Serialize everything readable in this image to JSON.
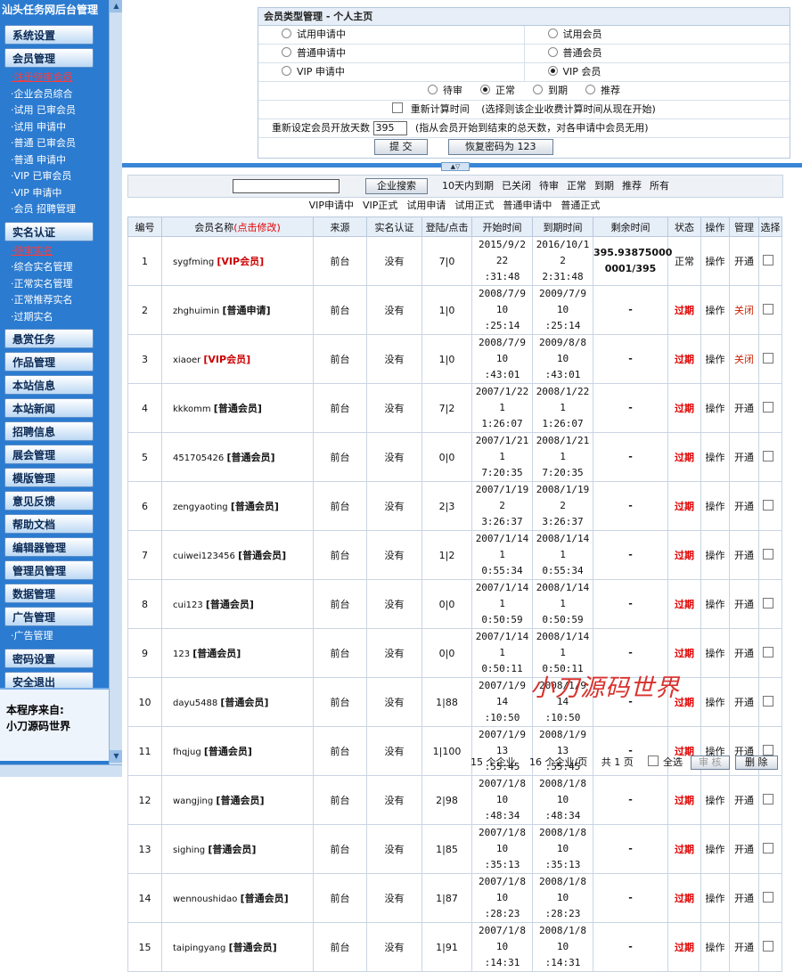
{
  "sidebar": {
    "title": "汕头任务网后台管理",
    "groups": {
      "g0": "系统设置",
      "g1": "会员管理",
      "g2": "实名认证",
      "g3": "悬赏任务",
      "g4": "作品管理",
      "g5": "本站信息",
      "g6": "本站新闻",
      "g7": "招聘信息",
      "g8": "展会管理",
      "g9": "模版管理",
      "g10": "意见反馈",
      "g11": "帮助文档",
      "g12": "编辑器管理",
      "g13": "管理员管理",
      "g14": "数据管理",
      "g15": "广告管理",
      "g16": "密码设置",
      "g17": "安全退出"
    },
    "member_subs": [
      "·注册待审会员",
      "·企业会员综合",
      "·试用 已审会员",
      "·试用 申请中",
      "·普通 已审会员",
      "·普通 申请中",
      "·VIP 已审会员",
      "·VIP 申请中",
      "·会员 招聘管理"
    ],
    "realname_subs": [
      "·待审实名",
      "·综合实名管理",
      "·正常实名管理",
      "·正常推荐实名",
      "·过期实名"
    ],
    "ad_subs": [
      "·广告管理"
    ],
    "footer_line1": "本程序来自:",
    "footer_line2": "小刀源码世界"
  },
  "topbox": {
    "header": "会员类型管理 - 个人主页",
    "types": [
      [
        "试用申请中",
        "试用会员"
      ],
      [
        "普通申请中",
        "普通会员"
      ],
      [
        "VIP 申请中",
        "VIP 会员"
      ]
    ],
    "selected_type": "VIP 会员",
    "statuses": [
      "待审",
      "正常",
      "到期",
      "推荐"
    ],
    "selected_status": "正常",
    "recalc_label": "重新计算时间",
    "recalc_hint": "(选择则该企业收费计算时间从现在开始)",
    "days_label": "重新设定会员开放天数",
    "days_value": "395",
    "days_hint": "(指从会员开始到结束的总天数，对各申请中会员无用)",
    "submit": "提 交",
    "reset_pwd": "恢复密码为 123"
  },
  "collapse_glyph": "▲▽",
  "search": {
    "button": "企业搜索",
    "filters": [
      "10天内到期",
      "已关闭",
      "待审",
      "正常",
      "到期",
      "推荐",
      "所有"
    ]
  },
  "type_filters": [
    "VIP申请中",
    "VIP正式",
    "试用申请",
    "试用正式",
    "普通申请中",
    "普通正式"
  ],
  "table": {
    "headers": {
      "no": "编号",
      "name": "会员名称",
      "name_hint": "(点击修改)",
      "source": "来源",
      "realname": "实名认证",
      "login": "登陆/点击",
      "start": "开始时间",
      "end": "到期时间",
      "remain": "剩余时间",
      "status": "状态",
      "op": "操作",
      "manage": "管理",
      "select": "选择"
    },
    "rows": [
      {
        "no": "1",
        "user": "sygfming",
        "type": "[VIP会员]",
        "vip": true,
        "source": "前台",
        "realname": "没有",
        "login": "7|0",
        "start": "2015/9/2 22:31:48",
        "end": "2016/10/1 22:31:48",
        "remain": "395.93875000 0001/395",
        "status": "正常",
        "op": "操作",
        "manage": "开通"
      },
      {
        "no": "2",
        "user": "zhghuimin",
        "type": "[普通申请]",
        "vip": false,
        "source": "前台",
        "realname": "没有",
        "login": "1|0",
        "start": "2008/7/9 10:25:14",
        "end": "2009/7/9 10:25:14",
        "remain": "-",
        "status": "过期",
        "op": "操作",
        "manage": "关闭"
      },
      {
        "no": "3",
        "user": "xiaoer",
        "type": "[VIP会员]",
        "vip": true,
        "source": "前台",
        "realname": "没有",
        "login": "1|0",
        "start": "2008/7/9 10:43:01",
        "end": "2009/8/8 10:43:01",
        "remain": "-",
        "status": "过期",
        "op": "操作",
        "manage": "关闭"
      },
      {
        "no": "4",
        "user": "kkkomm",
        "type": "[普通会员]",
        "vip": false,
        "source": "前台",
        "realname": "没有",
        "login": "7|2",
        "start": "2007/1/22 11:26:07",
        "end": "2008/1/22 11:26:07",
        "remain": "-",
        "status": "过期",
        "op": "操作",
        "manage": "开通"
      },
      {
        "no": "5",
        "user": "451705426",
        "type": "[普通会员]",
        "vip": false,
        "source": "前台",
        "realname": "没有",
        "login": "0|0",
        "start": "2007/1/21 17:20:35",
        "end": "2008/1/21 17:20:35",
        "remain": "-",
        "status": "过期",
        "op": "操作",
        "manage": "开通"
      },
      {
        "no": "6",
        "user": "zengyaoting",
        "type": "[普通会员]",
        "vip": false,
        "source": "前台",
        "realname": "没有",
        "login": "2|3",
        "start": "2007/1/19 23:26:37",
        "end": "2008/1/19 23:26:37",
        "remain": "-",
        "status": "过期",
        "op": "操作",
        "manage": "开通"
      },
      {
        "no": "7",
        "user": "cuiwei123456",
        "type": "[普通会员]",
        "vip": false,
        "source": "前台",
        "realname": "没有",
        "login": "1|2",
        "start": "2007/1/14 10:55:34",
        "end": "2008/1/14 10:55:34",
        "remain": "-",
        "status": "过期",
        "op": "操作",
        "manage": "开通"
      },
      {
        "no": "8",
        "user": "cui123",
        "type": "[普通会员]",
        "vip": false,
        "source": "前台",
        "realname": "没有",
        "login": "0|0",
        "start": "2007/1/14 10:50:59",
        "end": "2008/1/14 10:50:59",
        "remain": "-",
        "status": "过期",
        "op": "操作",
        "manage": "开通"
      },
      {
        "no": "9",
        "user": "123",
        "type": "[普通会员]",
        "vip": false,
        "source": "前台",
        "realname": "没有",
        "login": "0|0",
        "start": "2007/1/14 10:50:11",
        "end": "2008/1/14 10:50:11",
        "remain": "-",
        "status": "过期",
        "op": "操作",
        "manage": "开通"
      },
      {
        "no": "10",
        "user": "dayu5488",
        "type": "[普通会员]",
        "vip": false,
        "source": "前台",
        "realname": "没有",
        "login": "1|88",
        "start": "2007/1/9 14:10:50",
        "end": "2008/1/9 14:10:50",
        "remain": "-",
        "status": "过期",
        "op": "操作",
        "manage": "开通"
      },
      {
        "no": "11",
        "user": "fhqjug",
        "type": "[普通会员]",
        "vip": false,
        "source": "前台",
        "realname": "没有",
        "login": "1|100",
        "start": "2007/1/9 13:55:45",
        "end": "2008/1/9 13:55:45",
        "remain": "-",
        "status": "过期",
        "op": "操作",
        "manage": "开通"
      },
      {
        "no": "12",
        "user": "wangjing",
        "type": "[普通会员]",
        "vip": false,
        "source": "前台",
        "realname": "没有",
        "login": "2|98",
        "start": "2007/1/8 10:48:34",
        "end": "2008/1/8 10:48:34",
        "remain": "-",
        "status": "过期",
        "op": "操作",
        "manage": "开通"
      },
      {
        "no": "13",
        "user": "sighing",
        "type": "[普通会员]",
        "vip": false,
        "source": "前台",
        "realname": "没有",
        "login": "1|85",
        "start": "2007/1/8 10:35:13",
        "end": "2008/1/8 10:35:13",
        "remain": "-",
        "status": "过期",
        "op": "操作",
        "manage": "开通"
      },
      {
        "no": "14",
        "user": "wennoushidao",
        "type": "[普通会员]",
        "vip": false,
        "source": "前台",
        "realname": "没有",
        "login": "1|87",
        "start": "2007/1/8 10:28:23",
        "end": "2008/1/8 10:28:23",
        "remain": "-",
        "status": "过期",
        "op": "操作",
        "manage": "开通"
      },
      {
        "no": "15",
        "user": "taipingyang",
        "type": "[普通会员]",
        "vip": false,
        "source": "前台",
        "realname": "没有",
        "login": "1|91",
        "start": "2007/1/8 10:14:31",
        "end": "2008/1/8 10:14:31",
        "remain": "-",
        "status": "过期",
        "op": "操作",
        "manage": "开通"
      }
    ]
  },
  "footer": {
    "count": "15 个企业",
    "per_page": "16 个企业/页",
    "pages": "共 1 页",
    "select_all": "全选",
    "audit": "审 核",
    "delete": "删 除"
  },
  "watermark": "小刀源码世界",
  "colors": {
    "sidebar": "#2b7bd0",
    "expired": "#e00000",
    "vip": "#cc0000"
  }
}
